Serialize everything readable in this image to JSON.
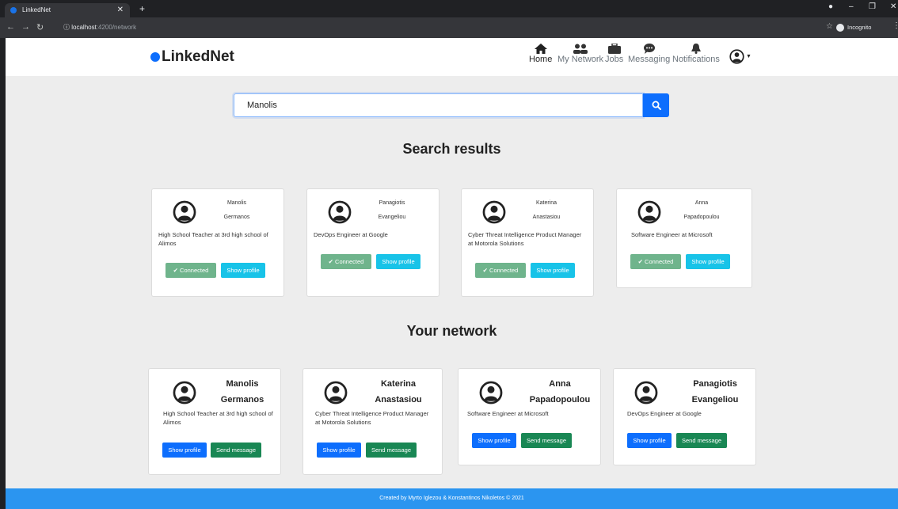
{
  "browser": {
    "tab_title": "LinkedNet",
    "url_host": "localhost",
    "url_path": ":4200/network",
    "incognito_label": "Incognito"
  },
  "navbar": {
    "brand": "LinkedNet",
    "items": [
      {
        "label": "Home",
        "icon": "home-icon"
      },
      {
        "label": "My Network",
        "icon": "users-icon"
      },
      {
        "label": "Jobs",
        "icon": "briefcase-icon"
      },
      {
        "label": "Messaging",
        "icon": "chat-icon"
      },
      {
        "label": "Notifications",
        "icon": "bell-icon"
      }
    ]
  },
  "search": {
    "value": "Manolis",
    "button_icon": "search-icon"
  },
  "results": {
    "title": "Search results",
    "connected_label": "✔ Connected",
    "show_label": "Show profile",
    "cards": [
      {
        "first": "Manolis",
        "last": "Germanos",
        "job": "High School Teacher at 3rd high school of Alimos"
      },
      {
        "first": "Panagiotis",
        "last": "Evangeliou",
        "job": "DevOps Engineer at Google"
      },
      {
        "first": "Katerina",
        "last": "Anastasiou",
        "job": "Cyber Threat Intelligence Product Manager at Motorola Solutions"
      },
      {
        "first": "Anna",
        "last": "Papadopoulou",
        "job": "Software Engineer at Microsoft"
      }
    ]
  },
  "network": {
    "title": "Your network",
    "show_label": "Show profile",
    "message_label": "Send message",
    "cards": [
      {
        "first": "Manolis",
        "last": "Germanos",
        "job": "High School Teacher at 3rd high school of Alimos"
      },
      {
        "first": "Katerina",
        "last": "Anastasiou",
        "job": "Cyber Threat Intelligence Product Manager at Motorola Solutions"
      },
      {
        "first": "Anna",
        "last": "Papadopoulou",
        "job": "Software Engineer at Microsoft"
      },
      {
        "first": "Panagiotis",
        "last": "Evangeliou",
        "job": "DevOps Engineer at Google"
      }
    ]
  },
  "footer": {
    "text": "Created by Myrto Iglezou & Konstantinos Nikoletos © 2021"
  },
  "colors": {
    "primary": "#0d6efd",
    "info": "#18c3e8",
    "success": "#198754",
    "connected": "#6fb48c",
    "footer": "#2b95f0"
  }
}
